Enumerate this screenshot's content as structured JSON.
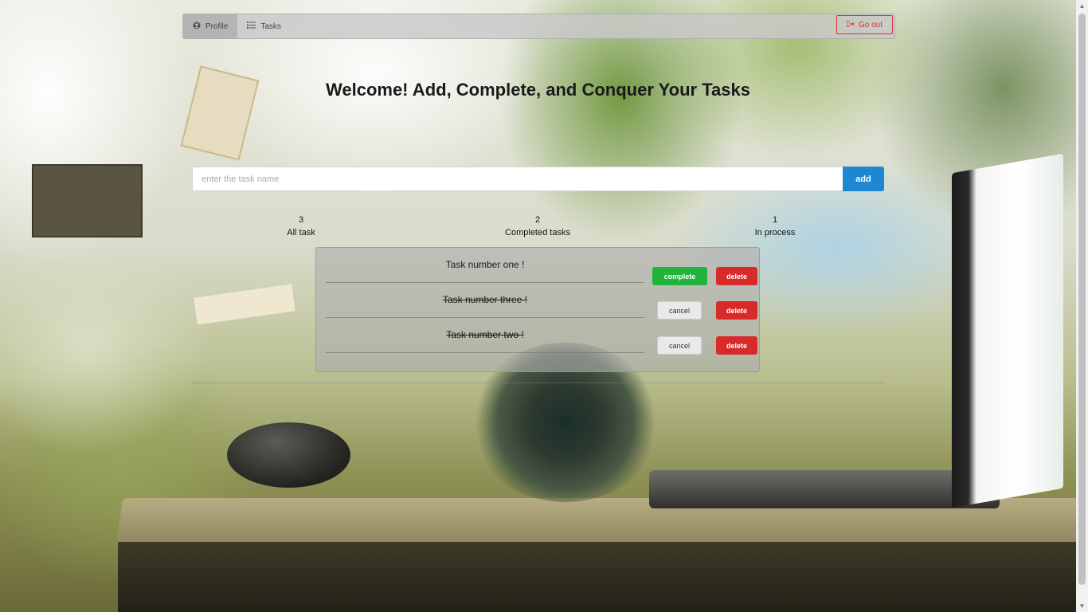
{
  "navbar": {
    "profile": {
      "label": "Profile",
      "icon": "user-circle-icon"
    },
    "tasks": {
      "label": "Tasks",
      "icon": "list-icon"
    },
    "go_out": {
      "label": "Go out",
      "icon": "sign-out-icon",
      "color": "#dd3333"
    }
  },
  "header": {
    "title": "Welcome! Add, Complete, and Conquer Your Tasks"
  },
  "form": {
    "placeholder": "enter the task name",
    "value": "",
    "add_label": "add"
  },
  "stats": {
    "all": {
      "count": "3",
      "label": "All task"
    },
    "completed": {
      "count": "2",
      "label": "Completed tasks"
    },
    "in_process": {
      "count": "1",
      "label": "In process"
    }
  },
  "tasks": [
    {
      "name": "Task number one !",
      "completed": false,
      "action_label": "complete",
      "delete_label": "delete"
    },
    {
      "name": "Task number three !",
      "completed": true,
      "action_label": "cancel",
      "delete_label": "delete"
    },
    {
      "name": "Task number two !",
      "completed": true,
      "action_label": "cancel",
      "delete_label": "delete"
    }
  ],
  "colors": {
    "accent": "#1f86d4",
    "complete": "#22b33a",
    "delete": "#d92a2a"
  }
}
